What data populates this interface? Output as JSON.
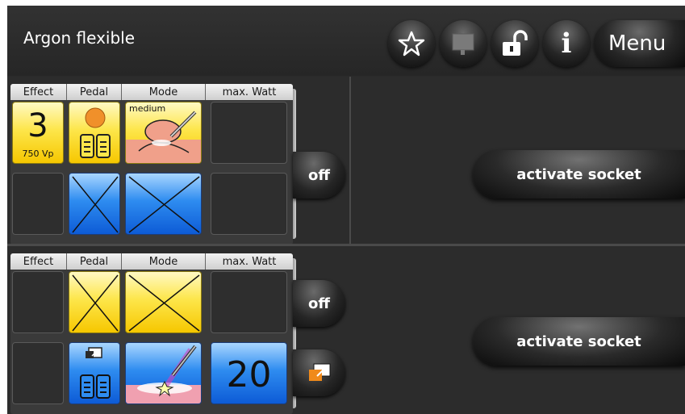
{
  "header": {
    "title": "Argon flexible",
    "menu_label": "Menu",
    "icons": [
      "star-icon",
      "message-icon",
      "lock-open-icon",
      "info-icon"
    ]
  },
  "columns": [
    "Effect",
    "Pedal",
    "Mode",
    "max. Watt"
  ],
  "socket1": {
    "row1": {
      "effect_value": "3",
      "effect_sub": "750 Vp",
      "mode_label": "medium"
    },
    "off_label": "off",
    "activate_label": "activate socket"
  },
  "socket2": {
    "row2": {
      "watt_value": "20"
    },
    "off_label": "off",
    "activate_label": "activate socket"
  },
  "colors": {
    "tile_yellow": "#fde64b",
    "tile_blue": "#2e8cf0",
    "background": "#2b2b2b"
  }
}
